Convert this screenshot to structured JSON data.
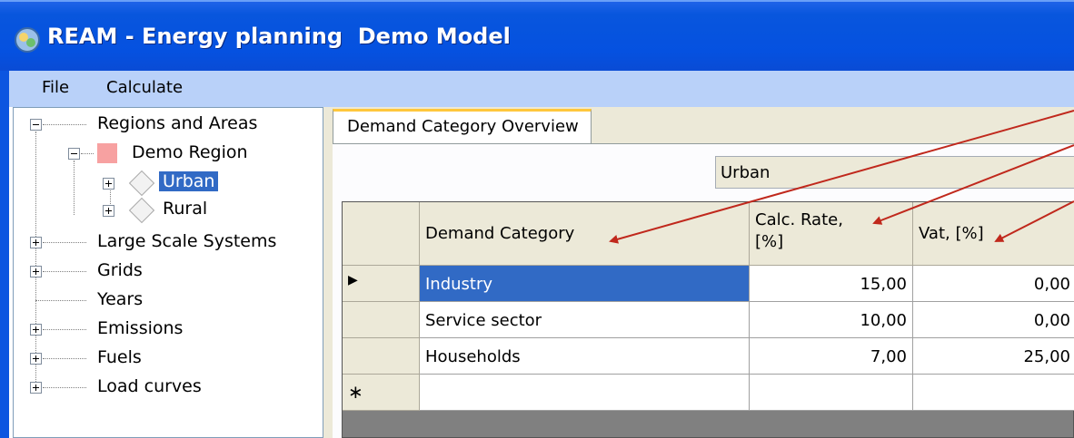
{
  "window": {
    "title": "REAM - Energy planning  Demo Model"
  },
  "menu": {
    "items": [
      "File",
      "Calculate"
    ]
  },
  "tree": {
    "root": "Regions and Areas",
    "region": "Demo Region",
    "areas": [
      "Urban",
      "Rural"
    ],
    "nodes": [
      "Large Scale Systems",
      "Grids",
      "Years",
      "Emissions",
      "Fuels",
      "Load curves"
    ]
  },
  "tab": {
    "label": "Demand Category Overview"
  },
  "region_selector": {
    "value": "Urban"
  },
  "grid": {
    "columns": [
      "Demand Category",
      "Calc. Rate,",
      "[%]",
      "Vat, [%]"
    ],
    "rows": [
      {
        "category": "Industry",
        "calc_rate": "15,00",
        "vat": "0,00"
      },
      {
        "category": "Service sector",
        "calc_rate": "10,00",
        "vat": "0,00"
      },
      {
        "category": "Households",
        "calc_rate": "7,00",
        "vat": "25,00"
      }
    ],
    "new_row_marker": "∗",
    "current_row_marker": "▶"
  },
  "colors": {
    "title_bar": "#0551e0",
    "menu_bar": "#b9d1f9",
    "selection": "#316ac5",
    "annotation_arrow": "#c0281c"
  }
}
